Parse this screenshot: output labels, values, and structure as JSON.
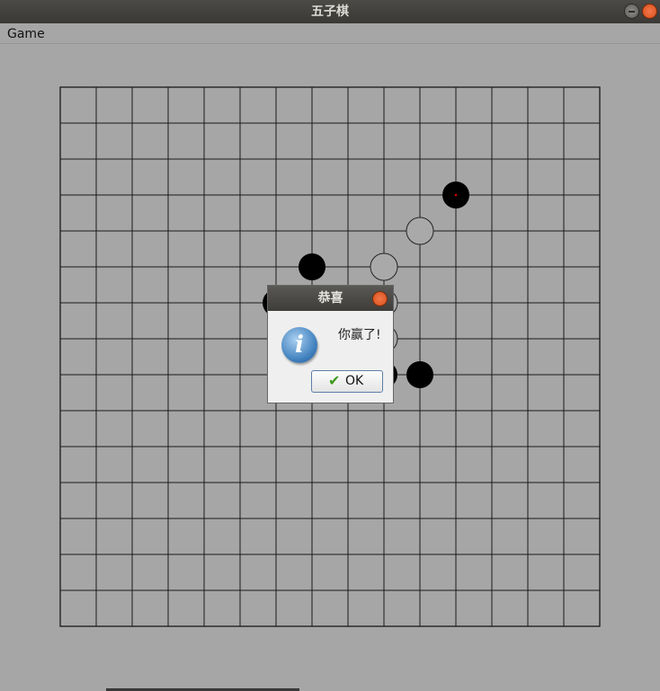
{
  "window": {
    "title": "五子棋"
  },
  "menu": {
    "items": [
      {
        "label": "Game"
      }
    ]
  },
  "board": {
    "size": 16,
    "stones": [
      {
        "col": 11,
        "row": 3,
        "color": "black",
        "marker": true
      },
      {
        "col": 10,
        "row": 4,
        "color": "white"
      },
      {
        "col": 7,
        "row": 5,
        "color": "black"
      },
      {
        "col": 9,
        "row": 5,
        "color": "white"
      },
      {
        "col": 6,
        "row": 6,
        "color": "black"
      },
      {
        "col": 9,
        "row": 6,
        "color": "white"
      },
      {
        "col": 9,
        "row": 7,
        "color": "white"
      },
      {
        "col": 9,
        "row": 8,
        "color": "black"
      },
      {
        "col": 10,
        "row": 8,
        "color": "black"
      }
    ],
    "colors": {
      "black": "#000000",
      "white": "#a9a9a9",
      "line": "#1a1a1a",
      "marker": "#cc0000"
    }
  },
  "dialog": {
    "title": "恭喜",
    "message": "你赢了!",
    "icon": "info-icon",
    "ok_label": "OK"
  }
}
